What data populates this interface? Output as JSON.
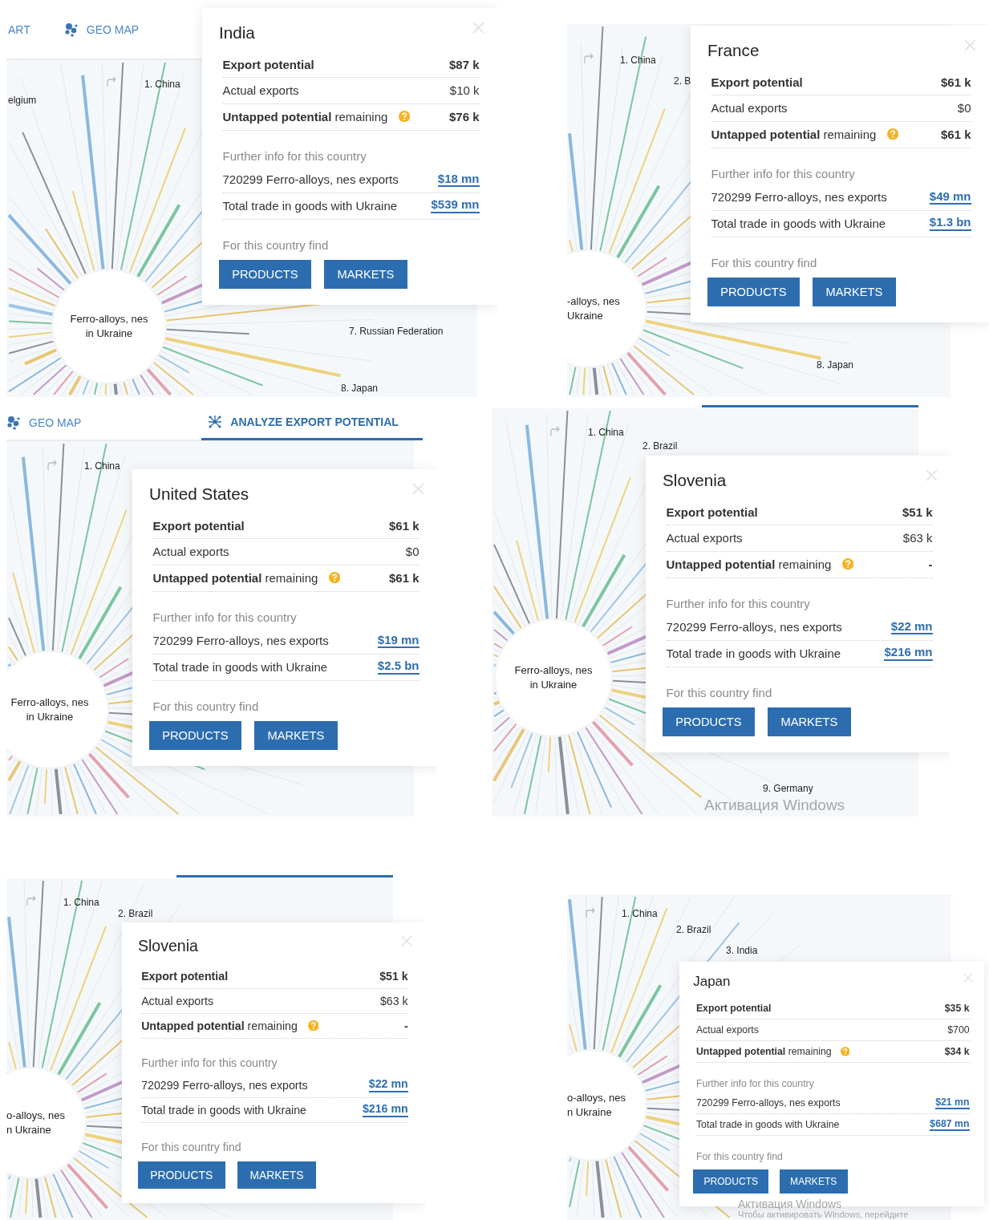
{
  "panels": [
    {
      "tabs": [
        {
          "label": "ART",
          "kind": "plain",
          "selected": false
        },
        {
          "label": "GEO MAP",
          "kind": "dots",
          "selected": false
        }
      ],
      "chart": {
        "labels": [
          "elgium",
          "1. China",
          "7. Russian Federation",
          "8. Japan"
        ],
        "hub_label": [
          "Ferro-alloys, nes",
          "in Ukraine"
        ]
      },
      "popup": {
        "title": "India",
        "rows": [
          {
            "label": "Export potential",
            "value": "$87 k",
            "emphasis": true,
            "help": false
          },
          {
            "label": "Actual exports",
            "value": "$10 k",
            "emphasis": false,
            "help": false
          },
          {
            "label": "**Untapped potential** remaining",
            "value": "$76 k",
            "emphasis": true,
            "help": true
          }
        ],
        "further": {
          "heading": "Further info for this country",
          "links": [
            {
              "label": "720299 Ferro-alloys, nes exports",
              "value": "$18 mn"
            },
            {
              "label": "Total trade in goods with Ukraine",
              "value": "$539 mn"
            }
          ]
        },
        "find": {
          "heading": "For this country find",
          "buttons": [
            "PRODUCTS",
            "MARKETS"
          ]
        }
      }
    },
    {
      "chart": {
        "labels": [
          "1. China",
          "2. B",
          "8. Japan"
        ],
        "hub_label": [
          "-alloys, nes",
          "Ukraine"
        ]
      },
      "popup": {
        "title": "France",
        "rows": [
          {
            "label": "Export potential",
            "value": "$61 k",
            "emphasis": true,
            "help": false
          },
          {
            "label": "Actual exports",
            "value": "$0",
            "emphasis": false,
            "help": false
          },
          {
            "label": "**Untapped potential** remaining",
            "value": "$61 k",
            "emphasis": true,
            "help": true
          }
        ],
        "further": {
          "heading": "Further info for this country",
          "links": [
            {
              "label": "720299 Ferro-alloys, nes exports",
              "value": "$49 mn"
            },
            {
              "label": "Total trade in goods with Ukraine",
              "value": "$1.3 bn"
            }
          ]
        },
        "find": {
          "heading": "For this country find",
          "buttons": [
            "PRODUCTS",
            "MARKETS"
          ]
        }
      }
    },
    {
      "tabs": [
        {
          "label": "GEO MAP",
          "kind": "dots",
          "selected": false
        },
        {
          "label": "ANALYZE EXPORT POTENTIAL",
          "kind": "network",
          "selected": true
        }
      ],
      "chart": {
        "labels": [
          "1. China"
        ],
        "hub_label": [
          "Ferro-alloys, nes",
          "in Ukraine"
        ]
      },
      "popup": {
        "title": "United States",
        "rows": [
          {
            "label": "Export potential",
            "value": "$61 k",
            "emphasis": true,
            "help": false
          },
          {
            "label": "Actual exports",
            "value": "$0",
            "emphasis": false,
            "help": false
          },
          {
            "label": "**Untapped potential** remaining",
            "value": "$61 k",
            "emphasis": true,
            "help": true
          }
        ],
        "further": {
          "heading": "Further info for this country",
          "links": [
            {
              "label": "720299 Ferro-alloys, nes exports",
              "value": "$19 mn"
            },
            {
              "label": "Total trade in goods with Ukraine",
              "value": "$2.5 bn"
            }
          ]
        },
        "find": {
          "heading": "For this country find",
          "buttons": [
            "PRODUCTS",
            "MARKETS"
          ]
        }
      }
    },
    {
      "tab_indicator": true,
      "chart": {
        "labels": [
          "1. China",
          "2. Brazil",
          "9. Germany"
        ],
        "hub_label": [
          "Ferro-alloys, nes",
          "in Ukraine"
        ]
      },
      "popup": {
        "title": "Slovenia",
        "rows": [
          {
            "label": "Export potential",
            "value": "$51 k",
            "emphasis": true,
            "help": false
          },
          {
            "label": "Actual exports",
            "value": "$63 k",
            "emphasis": false,
            "help": false
          },
          {
            "label": "**Untapped potential** remaining",
            "value": "-",
            "emphasis": true,
            "help": true
          }
        ],
        "further": {
          "heading": "Further info for this country",
          "links": [
            {
              "label": "720299 Ferro-alloys, nes exports",
              "value": "$22 mn"
            },
            {
              "label": "Total trade in goods with Ukraine",
              "value": "$216 mn"
            }
          ]
        },
        "find": {
          "heading": "For this country find",
          "buttons": [
            "PRODUCTS",
            "MARKETS"
          ]
        }
      },
      "watermark": [
        "Активация Windows"
      ]
    },
    {
      "tab_indicator": true,
      "chart": {
        "labels": [
          "1. China",
          "2. Brazil"
        ],
        "hub_label": [
          "o-alloys, nes",
          "n Ukraine"
        ]
      },
      "popup": {
        "title": "Slovenia",
        "rows": [
          {
            "label": "Export potential",
            "value": "$51 k",
            "emphasis": true,
            "help": false
          },
          {
            "label": "Actual exports",
            "value": "$63 k",
            "emphasis": false,
            "help": false
          },
          {
            "label": "**Untapped potential** remaining",
            "value": "-",
            "emphasis": true,
            "help": true
          }
        ],
        "further": {
          "heading": "Further info for this country",
          "links": [
            {
              "label": "720299 Ferro-alloys, nes exports",
              "value": "$22 mn"
            },
            {
              "label": "Total trade in goods with Ukraine",
              "value": "$216 mn"
            }
          ]
        },
        "find": {
          "heading": "For this country find",
          "buttons": [
            "PRODUCTS",
            "MARKETS"
          ]
        }
      }
    },
    {
      "chart": {
        "labels": [
          "1. China",
          "2. Brazil",
          "3. India"
        ],
        "hub_label": [
          "o-alloys, nes",
          "n Ukraine"
        ]
      },
      "popup": {
        "title": "Japan",
        "rows": [
          {
            "label": "Export potential",
            "value": "$35 k",
            "emphasis": true,
            "help": false
          },
          {
            "label": "Actual exports",
            "value": "$700",
            "emphasis": false,
            "help": false
          },
          {
            "label": "**Untapped potential** remaining",
            "value": "$34 k",
            "emphasis": true,
            "help": true
          }
        ],
        "further": {
          "heading": "Further info for this country",
          "links": [
            {
              "label": "720299 Ferro-alloys, nes exports",
              "value": "$21 mn"
            },
            {
              "label": "Total trade in goods with Ukraine",
              "value": "$687 mn"
            }
          ]
        },
        "find": {
          "heading": "For this country find",
          "buttons": [
            "PRODUCTS",
            "MARKETS"
          ]
        }
      },
      "watermark": [
        "Активация Windows",
        "Чтобы активировать Windows, перейдите"
      ]
    }
  ]
}
